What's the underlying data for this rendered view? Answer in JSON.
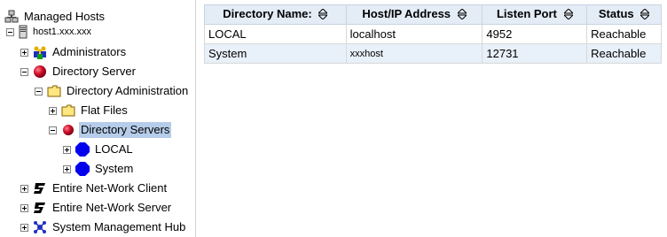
{
  "tree": {
    "root": "Managed Hosts",
    "host": "host1.xxx.xxx",
    "administrators": "Administrators",
    "directory_server": "Directory Server",
    "directory_administration": "Directory Administration",
    "flat_files": "Flat Files",
    "directory_servers": "Directory Servers",
    "local": "LOCAL",
    "system": "System",
    "entire_client": "Entire Net-Work Client",
    "entire_server": "Entire Net-Work Server",
    "smh": "System Management Hub"
  },
  "table": {
    "columns": [
      "Directory Name:",
      "Host/IP Address",
      "Listen Port",
      "Status"
    ],
    "rows": [
      [
        "LOCAL",
        "localhost",
        "4952",
        "Reachable"
      ],
      [
        "System",
        "xxxhost",
        "12731",
        "Reachable"
      ]
    ]
  },
  "colors": {
    "selection": "#b6cdea",
    "header_bg": "#e4ecf6",
    "alt_row": "#e8f0fa",
    "red_sphere": "#d0102a",
    "blue_octagon": "#0000ee",
    "folder": "#ffe680"
  }
}
